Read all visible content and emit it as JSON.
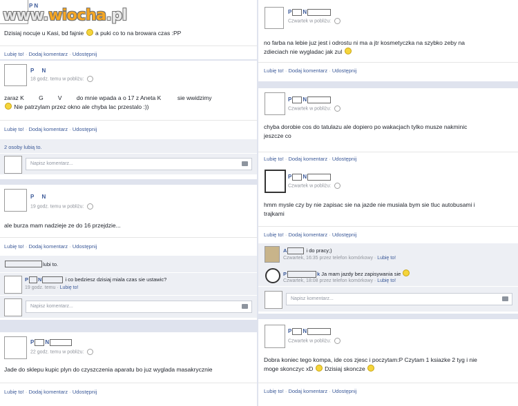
{
  "watermark": {
    "prefix": "www.",
    "brand": "wiocha",
    "suffix": ".pl"
  },
  "actions": {
    "like": "Lubię to!",
    "comment": "Dodaj komentarz",
    "share": "Udostępnij",
    "sep": "·"
  },
  "comment_placeholder": "Napisz komentarz...",
  "left": {
    "post1": {
      "name": "P   N",
      "text_a": "Dzisiaj nocuje u Kasi, bd fajnie",
      "text_b": "a puki co to na browara czas :PP"
    },
    "post2": {
      "name_p": "P",
      "name_n": "N",
      "meta": "18 godz. temu w pobliżu:",
      "text_line1": "zaraz K         G         V         do mnie wpada a o 17 z Aneta K          sie wwidzimy",
      "text_line2": "Nie patrzylam przez okno ale chyba lac przestalo :))",
      "likes": "2 osoby lubią to."
    },
    "post3": {
      "name_p": "P",
      "name_n": "N",
      "meta": "19 godz. temu w pobliżu:",
      "text": "ale burza mam nadzieje ze do 16 przejdzie...",
      "likes_suffix": "lubi to.",
      "comment_name_p": "P",
      "comment_name_n": "N",
      "comment_text": "i co bedziesz dzisiaj miala czas sie ustawic?",
      "comment_meta_time": "19 godz. temu",
      "comment_like": "Lubię to!"
    },
    "post4": {
      "name_p": "P",
      "name_n": "N",
      "meta": "22 godz. temu w pobliżu:",
      "text": "Jade do sklepu kupic plyn do czyszczenia aparatu bo juz wyglada masakrycznie"
    }
  },
  "right": {
    "post1": {
      "name_p": "P",
      "name_n": "N",
      "meta": "Czwartek w pobliżu:",
      "text_line1": "no farba na lebie juz jest i odrostu ni ma a jtr kosmetyczka na szybko zeby na",
      "text_line2": "zdieciach nie wygladac jak zul"
    },
    "post2": {
      "name_p": "P",
      "name_n": "N",
      "meta": "Czwartek w pobliżu:",
      "text_line1": "chyba dorobie cos do tatulazu ale dopiero po wakacjach tylko musze nakminic",
      "text_line2": "jeszcze co"
    },
    "post3": {
      "name_p": "P",
      "name_n": "N",
      "meta": "Czwartek w pobliżu:",
      "text_line1": "hmm mysle czy by nie zapisac sie na jazde nie musiala bym sie tluc autobusami i",
      "text_line2": "trajkami",
      "c1_name": "A",
      "c1_text": "i do pracy;)",
      "c1_meta": "Czwartek, 16:35 przez telefon komórkowy",
      "c2_name_p": "P",
      "c2_name_k": "k",
      "c2_text": "Ja mam jazdy bez zapisywania sie",
      "c2_meta": "Czwartek, 18:08 przez telefon komórkowy"
    },
    "post4": {
      "name_p": "P",
      "name_n": "N",
      "meta": "Czwartek w pobliżu:",
      "text_line1": "Dobra koniec tego kompa, ide cos zjesc i poczytam:P Czytam 1 ksiazke 2 tyg i nie",
      "text_line2": "moge skonczyc xD",
      "text_line2b": "Dzisiaj skoncze"
    }
  }
}
